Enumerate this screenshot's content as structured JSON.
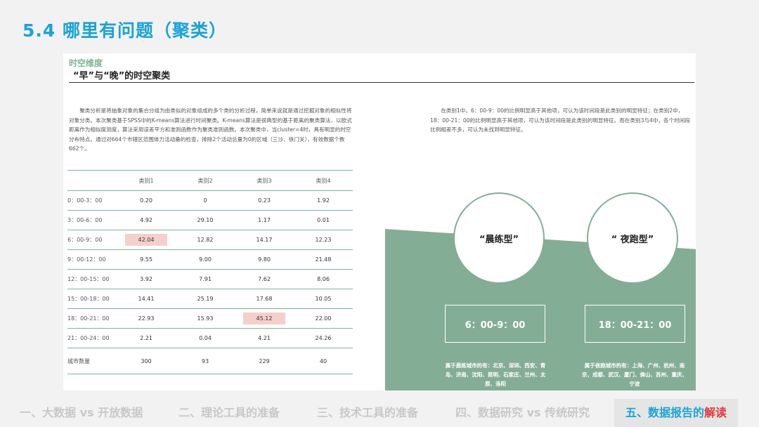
{
  "title": "5.4 哪里有问题（聚类）",
  "section": {
    "tag": "时空维度",
    "title": "“早”与“晚”的时空聚类"
  },
  "paragraph_left": "聚类分析是将抽象对象的集合分组为由类似的对象组成的多个类的分析过程，简单来说就是通过挖掘对象的相似性将对象分类。本次聚类基于SPSS中的K-means算法进行时间聚类。K-means算法是很典型的基于距离的聚类算法，以欧式距离作为相似度测度，算法采用误差平方和准则函数作为聚类准则函数。本次聚类中，当cluster=4时，具有明显的时空分布特点。通过对664个市辖区范围体力活动量的检查，排除2个活动总量为0的区域（三沙、铁门关），有效数据个数662个。",
  "paragraph_right": "在类别1中，6：00-9：00的比例明显高于其他项，可认为该时间段是此类别的明显特征；在类别2中，18：00-21：00的比例明显高于其他项，可认为该时间段是此类别的明显特征。而在类别3与4中，各个时间段比例相差不多，可认为未找到明显特征。",
  "table": {
    "headers": [
      "",
      "类别1",
      "类别2",
      "类别3",
      "类别4"
    ],
    "rows": [
      {
        "time": "0：00-3：00",
        "v": [
          "0.20",
          "0",
          "0.23",
          "1.92"
        ]
      },
      {
        "time": "3：00-6：00",
        "v": [
          "4.92",
          "29.10",
          "1.17",
          "0.01"
        ]
      },
      {
        "time": "6：00-9：00",
        "v": [
          "42.04",
          "12.82",
          "14.17",
          "12.23"
        ]
      },
      {
        "time": "9：00-12：00",
        "v": [
          "9.55",
          "9.00",
          "9.80",
          "21.48"
        ]
      },
      {
        "time": "12：00-15：00",
        "v": [
          "3.92",
          "7.91",
          "7.62",
          "8.06"
        ]
      },
      {
        "time": "15：00-18：00",
        "v": [
          "14.41",
          "25.19",
          "17.68",
          "10.05"
        ]
      },
      {
        "time": "18：00-21：00",
        "v": [
          "22.93",
          "15.93",
          "45.12",
          "22.00"
        ]
      },
      {
        "time": "21：00-24：00",
        "v": [
          "2.21",
          "0.04",
          "4.21",
          "24.26"
        ]
      },
      {
        "time": "城市数量",
        "v": [
          "300",
          "93",
          "229",
          "40"
        ]
      }
    ],
    "highlight_color": "#f5cfcb"
  },
  "types": [
    {
      "name": "“晨练型”",
      "time": "6：00-9：00",
      "cities": "属于晨练城市的有：北京、深圳、西安、青岛、济南、沈阳、昆明、石家庄、兰州、太原、洛阳"
    },
    {
      "name": "“ 夜跑型”",
      "time": "18：00-21：00",
      "cities": "属于夜跑城市的有：上海、广州、杭州、南京、成都、武汉、厦门、佛山、苏州、重庆、宁波"
    }
  ],
  "nav": {
    "items": [
      "一、大数据 vs 开放数据",
      "二、理论工具的准备",
      "三、技术工具的准备",
      "四、数据研究 vs 传统研究"
    ],
    "active_prefix": "五、数据报告的",
    "active_suffix": "解读"
  },
  "colors": {
    "title_blue": "#1aa3d6",
    "green": "#84ad95",
    "red": "#e0393e"
  }
}
